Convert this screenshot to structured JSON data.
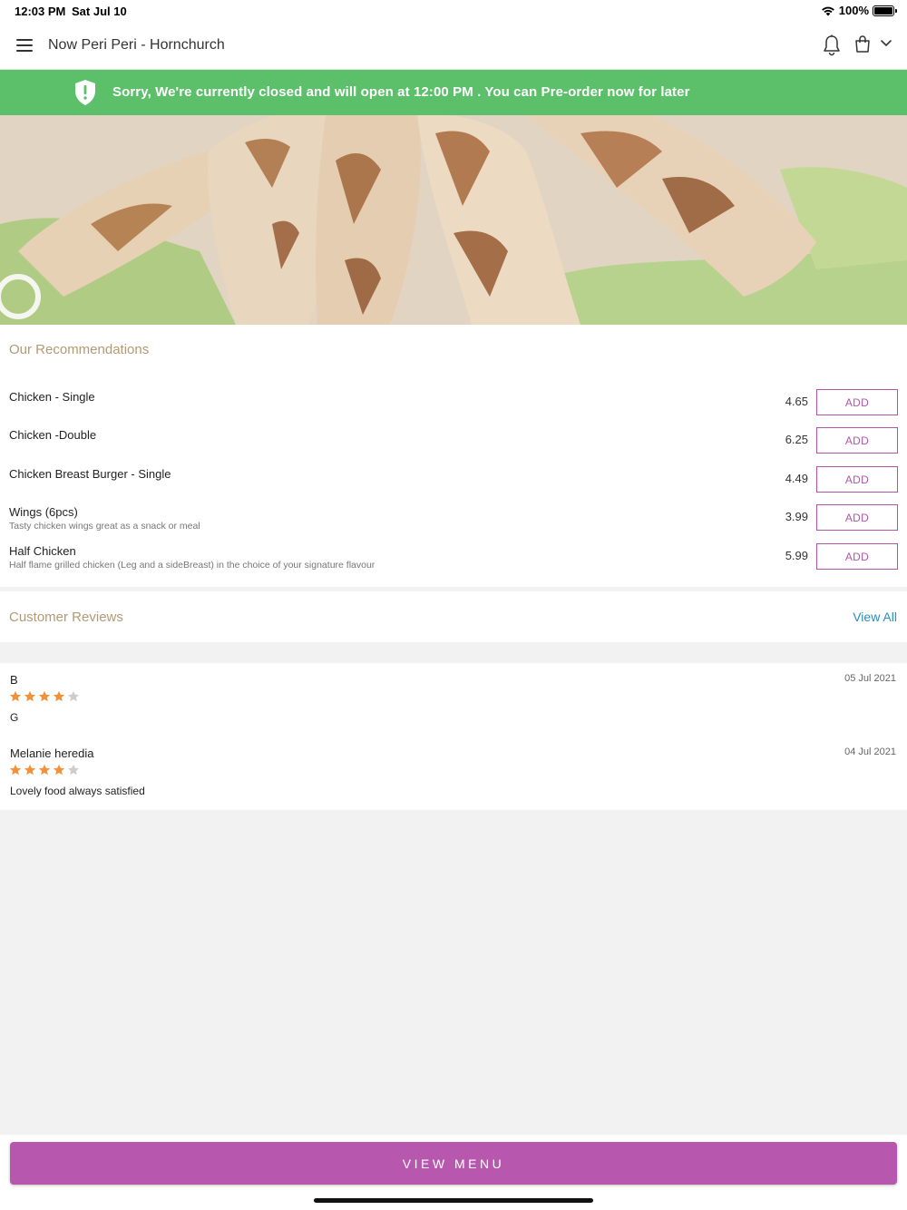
{
  "status_bar": {
    "time": "12:03 PM",
    "date": "Sat Jul 10",
    "battery": "100%"
  },
  "nav": {
    "title": "Now Peri Peri - Hornchurch",
    "icons": [
      "menu-icon",
      "bell-icon",
      "bag-icon",
      "chevron-down-icon"
    ]
  },
  "banner": {
    "text": "Sorry, We're currently closed and will open at 12:00 PM . You can Pre-order now for later",
    "color": "#5cbf6a"
  },
  "recommendations": {
    "title": "Our Recommendations",
    "add_label": "ADD",
    "items": [
      {
        "name": "Chicken - Single",
        "description": "",
        "price": "4.65"
      },
      {
        "name": "Chicken -Double",
        "description": "",
        "price": "6.25"
      },
      {
        "name": "Chicken Breast Burger - Single",
        "description": "",
        "price": "4.49"
      },
      {
        "name": "Wings (6pcs)",
        "description": "Tasty chicken wings great as a snack or meal",
        "price": "3.99"
      },
      {
        "name": "Half Chicken",
        "description": "Half flame grilled chicken (Leg and a sideBreast) in the choice of your signature flavour",
        "price": "5.99"
      }
    ]
  },
  "reviews": {
    "title": "Customer Reviews",
    "view_all": "View All",
    "items": [
      {
        "name": "B",
        "date": "05 Jul 2021",
        "rating": 4,
        "text": "G"
      },
      {
        "name": "Melanie heredia",
        "date": "04 Jul 2021",
        "rating": 4,
        "text": "Lovely food always satisfied"
      }
    ]
  },
  "footer": {
    "view_menu": "VIEW MENU"
  },
  "colors": {
    "accent": "#b758ae",
    "section_title": "#b19a73",
    "link": "#2a8dba",
    "star_filled": "#f0923a",
    "star_empty": "#cccccc"
  }
}
